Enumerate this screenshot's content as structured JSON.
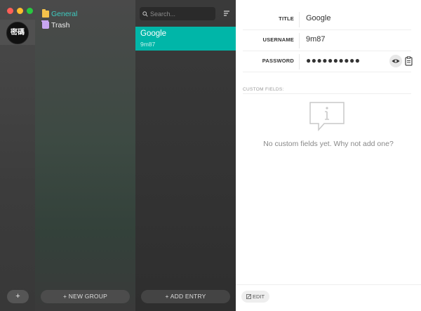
{
  "vaults": {
    "active_label": "密碼",
    "add_label": "+"
  },
  "groups": {
    "items": [
      {
        "label": "General",
        "icon": "folder-icon",
        "color": "#3ecbc0"
      },
      {
        "label": "Trash",
        "icon": "trash-icon",
        "color": "#eeeeee"
      }
    ],
    "new_group_label": "+ NEW GROUP"
  },
  "entries": {
    "search_placeholder": "Search...",
    "items": [
      {
        "title": "Google",
        "username": "9m87",
        "selected": true
      }
    ],
    "add_entry_label": "+ ADD ENTRY",
    "selected_color": "#00b6a8"
  },
  "detail": {
    "fields": [
      {
        "label": "TITLE",
        "value": "Google"
      },
      {
        "label": "USERNAME",
        "value": "9m87"
      },
      {
        "label": "PASSWORD",
        "value": "●●●●●●●●●●"
      }
    ],
    "custom_fields_label": "CUSTOM FIELDS:",
    "empty_message": "No custom fields yet. Why not add one?",
    "edit_label": "EDIT"
  },
  "colors": {
    "accent": "#00b6a8",
    "general_folder": "#f3c24b",
    "trash": "#c8a6f2"
  }
}
